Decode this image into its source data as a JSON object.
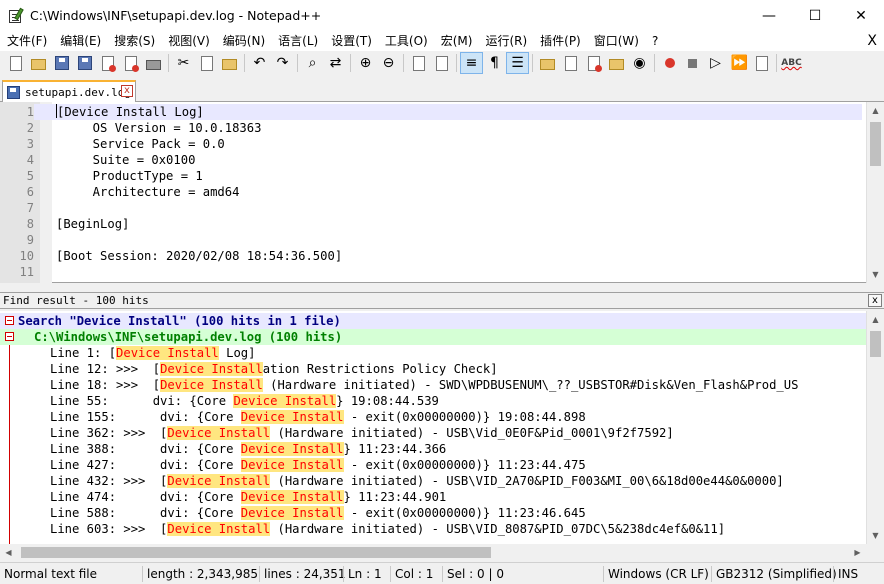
{
  "window": {
    "title": "C:\\Windows\\INF\\setupapi.dev.log - Notepad++",
    "minimize": "—",
    "maximize": "☐",
    "close": "✕"
  },
  "menu": {
    "items": [
      "文件(F)",
      "编辑(E)",
      "搜索(S)",
      "视图(V)",
      "编码(N)",
      "语言(L)",
      "设置(T)",
      "工具(O)",
      "宏(M)",
      "运行(R)",
      "插件(P)",
      "窗口(W)",
      "?"
    ],
    "close_doc": "X"
  },
  "toolbar": {
    "buttons": [
      {
        "name": "new-file",
        "icon": "new-file-icon"
      },
      {
        "name": "open-file",
        "icon": "open-folder-icon"
      },
      {
        "name": "save",
        "icon": "save-icon"
      },
      {
        "name": "save-all",
        "icon": "save-all-icon"
      },
      {
        "name": "close",
        "icon": "close-file-icon"
      },
      {
        "name": "close-all",
        "icon": "close-all-icon"
      },
      {
        "name": "print",
        "icon": "print-icon"
      },
      {
        "name": "cut",
        "icon": "cut-icon"
      },
      {
        "name": "copy",
        "icon": "copy-icon"
      },
      {
        "name": "paste",
        "icon": "paste-icon"
      },
      {
        "name": "undo",
        "icon": "undo-icon"
      },
      {
        "name": "redo",
        "icon": "redo-icon"
      },
      {
        "name": "find",
        "icon": "find-icon"
      },
      {
        "name": "replace",
        "icon": "replace-icon"
      },
      {
        "name": "zoom-in",
        "icon": "zoom-in-icon"
      },
      {
        "name": "zoom-out",
        "icon": "zoom-out-icon"
      },
      {
        "name": "sync-vertical",
        "icon": "sync-vertical-icon"
      },
      {
        "name": "sync-horizontal",
        "icon": "sync-horizontal-icon"
      },
      {
        "name": "word-wrap",
        "icon": "word-wrap-icon"
      },
      {
        "name": "show-all-chars",
        "icon": "pilcrow-icon"
      },
      {
        "name": "indent-guide",
        "icon": "indent-guide-icon"
      },
      {
        "name": "udl",
        "icon": "udl-icon"
      },
      {
        "name": "doc-map",
        "icon": "doc-map-icon"
      },
      {
        "name": "function-list",
        "icon": "function-list-icon"
      },
      {
        "name": "folder-workspace",
        "icon": "folder-workspace-icon"
      },
      {
        "name": "monitoring",
        "icon": "eye-icon"
      },
      {
        "name": "record-macro",
        "icon": "record-icon"
      },
      {
        "name": "stop-macro",
        "icon": "stop-icon"
      },
      {
        "name": "play-macro",
        "icon": "play-icon"
      },
      {
        "name": "run-macro-multiple",
        "icon": "fast-forward-icon"
      },
      {
        "name": "save-macro",
        "icon": "save-macro-icon"
      },
      {
        "name": "spell-check",
        "icon": "spell-check-icon"
      }
    ],
    "pilcrow": "¶",
    "spell": "ABC"
  },
  "tab": {
    "label": "setupapi.dev.log",
    "close": "x"
  },
  "editor": {
    "lines": [
      {
        "n": "1",
        "text": "[Device Install Log]"
      },
      {
        "n": "2",
        "text": "     OS Version = 10.0.18363"
      },
      {
        "n": "3",
        "text": "     Service Pack = 0.0"
      },
      {
        "n": "4",
        "text": "     Suite = 0x0100"
      },
      {
        "n": "5",
        "text": "     ProductType = 1"
      },
      {
        "n": "6",
        "text": "     Architecture = amd64"
      },
      {
        "n": "7",
        "text": ""
      },
      {
        "n": "8",
        "text": "[BeginLog]"
      },
      {
        "n": "9",
        "text": ""
      },
      {
        "n": "10",
        "text": "[Boot Session: 2020/02/08 18:54:36.500]"
      },
      {
        "n": "11",
        "text": ""
      }
    ]
  },
  "find_panel": {
    "title": "Find result - 100 hits",
    "close": "x",
    "search_header": "Search \"Device Install\" (100 hits in 1 file)",
    "file_header": "C:\\Windows\\INF\\setupapi.dev.log (100 hits)",
    "hits": [
      {
        "pre": "Line 1: [",
        "match": "Device Install",
        "post": " Log]"
      },
      {
        "pre": "Line 12: >>>  [",
        "match": "Device Install",
        "post": "ation Restrictions Policy Check]"
      },
      {
        "pre": "Line 18: >>>  [",
        "match": "Device Install",
        "post": " (Hardware initiated) - SWD\\WPDBUSENUM\\_??_USBSTOR#Disk&Ven_Flash&Prod_US"
      },
      {
        "pre": "Line 55:      dvi: {Core ",
        "match": "Device Install",
        "post": "} 19:08:44.539"
      },
      {
        "pre": "Line 155:      dvi: {Core ",
        "match": "Device Install",
        "post": " - exit(0x00000000)} 19:08:44.898"
      },
      {
        "pre": "Line 362: >>>  [",
        "match": "Device Install",
        "post": " (Hardware initiated) - USB\\Vid_0E0F&Pid_0001\\9f2f7592]"
      },
      {
        "pre": "Line 388:      dvi: {Core ",
        "match": "Device Install",
        "post": "} 11:23:44.366"
      },
      {
        "pre": "Line 427:      dvi: {Core ",
        "match": "Device Install",
        "post": " - exit(0x00000000)} 11:23:44.475"
      },
      {
        "pre": "Line 432: >>>  [",
        "match": "Device Install",
        "post": " (Hardware initiated) - USB\\VID_2A70&PID_F003&MI_00\\6&18d00e44&0&0000]"
      },
      {
        "pre": "Line 474:      dvi: {Core ",
        "match": "Device Install",
        "post": "} 11:23:44.901"
      },
      {
        "pre": "Line 588:      dvi: {Core ",
        "match": "Device Install",
        "post": " - exit(0x00000000)} 11:23:46.645"
      },
      {
        "pre": "Line 603: >>>  [",
        "match": "Device Install",
        "post": " (Hardware initiated) - USB\\VID_8087&PID_07DC\\5&238dc4ef&0&11]"
      }
    ]
  },
  "status": {
    "file_type": "Normal text file",
    "length": "length : 2,343,985",
    "lines": "lines : 24,351",
    "ln": "Ln : 1",
    "col": "Col : 1",
    "sel": "Sel : 0 | 0",
    "eol": "Windows (CR LF)",
    "encoding": "GB2312 (Simplified)",
    "mode": "INS"
  }
}
